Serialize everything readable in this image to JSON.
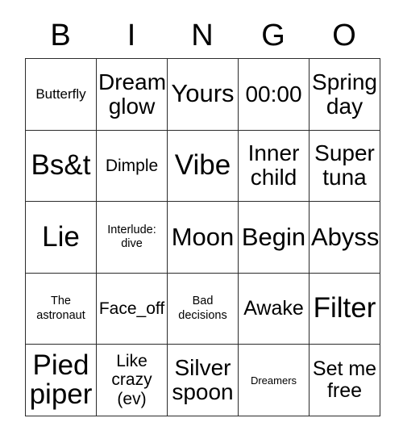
{
  "card": {
    "title": "BINGO",
    "header_letters": [
      "B",
      "I",
      "N",
      "G",
      "O"
    ],
    "grid_size": "5x5",
    "colors": {
      "background": "#ffffff",
      "text": "#000000",
      "border": "#2b2b2b"
    },
    "rows": [
      [
        {
          "label": "Butterfly",
          "size": "fs-m"
        },
        {
          "label": "Dream\nglow",
          "size": "fs-xl"
        },
        {
          "label": "Yours",
          "size": "fs-xxl"
        },
        {
          "label": "00:00",
          "size": "fs-xl"
        },
        {
          "label": "Spring\nday",
          "size": "fs-xl"
        }
      ],
      [
        {
          "label": "Bs&t",
          "size": "fs-huge"
        },
        {
          "label": "Dimple",
          "size": "fs-ml"
        },
        {
          "label": "Vibe",
          "size": "fs-huge"
        },
        {
          "label": "Inner\nchild",
          "size": "fs-xl"
        },
        {
          "label": "Super\ntuna",
          "size": "fs-xl"
        }
      ],
      [
        {
          "label": "Lie",
          "size": "fs-huge"
        },
        {
          "label": "Interlude:\ndive",
          "size": "fs-s"
        },
        {
          "label": "Moon",
          "size": "fs-xxl"
        },
        {
          "label": "Begin",
          "size": "fs-xxl"
        },
        {
          "label": "Abyss",
          "size": "fs-xxl"
        }
      ],
      [
        {
          "label": "The\nastronaut",
          "size": "fs-s"
        },
        {
          "label": "Face_off",
          "size": "fs-ml"
        },
        {
          "label": "Bad\ndecisions",
          "size": "fs-s"
        },
        {
          "label": "Awake",
          "size": "fs-l"
        },
        {
          "label": "Filter",
          "size": "fs-huge"
        }
      ],
      [
        {
          "label": "Pied\npiper",
          "size": "fs-huge"
        },
        {
          "label": "Like\ncrazy\n(ev)",
          "size": "fs-ml"
        },
        {
          "label": "Silver\nspoon",
          "size": "fs-xl"
        },
        {
          "label": "Dreamers",
          "size": "fs-xs"
        },
        {
          "label": "Set me\nfree",
          "size": "fs-l"
        }
      ]
    ]
  }
}
